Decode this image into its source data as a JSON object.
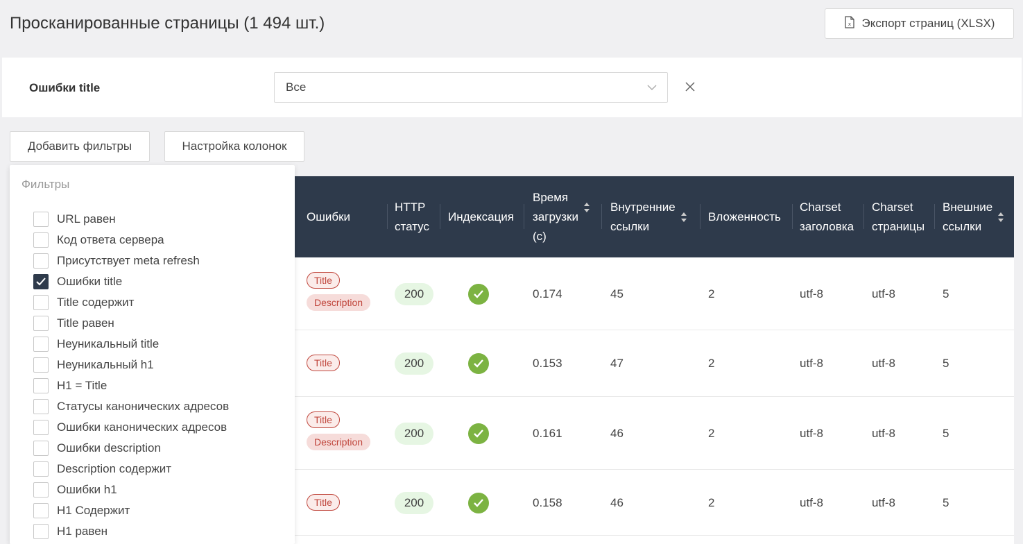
{
  "page": {
    "title": "Просканированные страницы (1 494 шт.)"
  },
  "header": {
    "export_label": "Экспорт страниц (XLSX)",
    "export_icon": "excel-file-icon"
  },
  "filter": {
    "label": "Ошибки title",
    "select_value": "Все",
    "clear_icon": "close-icon"
  },
  "buttons": {
    "add_filters": "Добавить фильтры",
    "columns": "Настройка колонок"
  },
  "dropdown": {
    "title": "Фильтры",
    "options": [
      {
        "label": "URL равен",
        "checked": false
      },
      {
        "label": "Код ответа сервера",
        "checked": false
      },
      {
        "label": "Присутствует meta refresh",
        "checked": false
      },
      {
        "label": "Ошибки title",
        "checked": true
      },
      {
        "label": "Title содержит",
        "checked": false
      },
      {
        "label": "Title равен",
        "checked": false
      },
      {
        "label": "Неуникальный title",
        "checked": false
      },
      {
        "label": "Неуникальный h1",
        "checked": false
      },
      {
        "label": "H1 = Title",
        "checked": false
      },
      {
        "label": "Статусы канонических адресов",
        "checked": false
      },
      {
        "label": "Ошибки канонических адресов",
        "checked": false
      },
      {
        "label": "Ошибки description",
        "checked": false
      },
      {
        "label": "Description содержит",
        "checked": false
      },
      {
        "label": "Ошибки h1",
        "checked": false
      },
      {
        "label": "H1 Содержит",
        "checked": false
      },
      {
        "label": "H1 равен",
        "checked": false
      }
    ]
  },
  "table": {
    "columns": {
      "errors": "Ошибки",
      "http_1": "HTTP",
      "http_2": "статус",
      "indexing": "Индексация",
      "load_1": "Время",
      "load_2": "загрузки",
      "load_3": "(с)",
      "internal_1": "Внутренние",
      "internal_2": "ссылки",
      "depth": "Вложенность",
      "charset_h_1": "Charset",
      "charset_h_2": "заголовка",
      "charset_p_1": "Charset",
      "charset_p_2": "страницы",
      "external_1": "Внешние",
      "external_2": "ссылки"
    },
    "rows": [
      {
        "errors": [
          "Title",
          "Description"
        ],
        "status": "200",
        "load": "0.174",
        "internal": "45",
        "depth": "2",
        "charset_header": "utf-8",
        "charset_page": "utf-8",
        "external": "5"
      },
      {
        "errors": [
          "Title"
        ],
        "status": "200",
        "load": "0.153",
        "internal": "47",
        "depth": "2",
        "charset_header": "utf-8",
        "charset_page": "utf-8",
        "external": "5"
      },
      {
        "errors": [
          "Title",
          "Description"
        ],
        "status": "200",
        "load": "0.161",
        "internal": "46",
        "depth": "2",
        "charset_header": "utf-8",
        "charset_page": "utf-8",
        "external": "5"
      },
      {
        "errors": [
          "Title"
        ],
        "status": "200",
        "load": "0.158",
        "internal": "46",
        "depth": "2",
        "charset_header": "utf-8",
        "charset_page": "utf-8",
        "external": "5"
      }
    ]
  },
  "colors": {
    "header_bg": "#2e3a4b",
    "check_green": "#7cb342",
    "tag_red": "#c0463c",
    "status_bg": "#e6f6e3"
  }
}
